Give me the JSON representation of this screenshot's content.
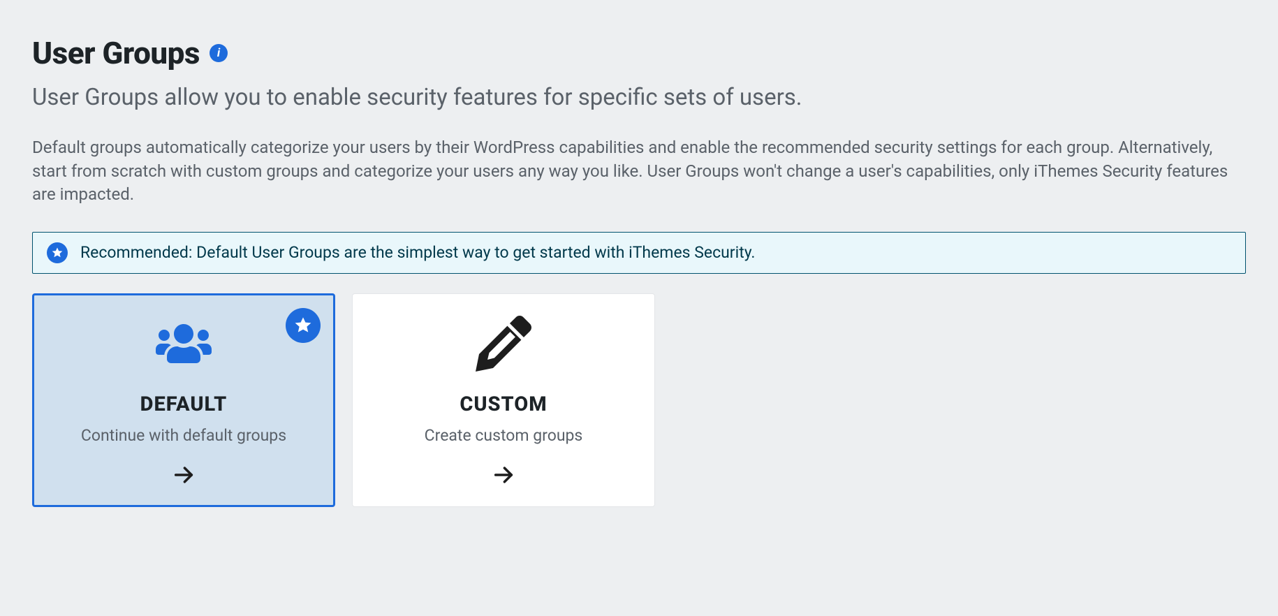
{
  "header": {
    "title": "User Groups",
    "info_icon": "info-icon"
  },
  "lead": "User Groups allow you to enable security features for specific sets of users.",
  "description": "Default groups automatically categorize your users by their WordPress capabilities and enable the recommended security settings for each group. Alternatively, start from scratch with custom groups and categorize your users any way you like. User Groups won't change a user's capabilities, only iThemes Security features are impacted.",
  "banner": {
    "text": "Recommended: Default User Groups are the simplest way to get started with iThemes Security."
  },
  "cards": {
    "default": {
      "title": "DEFAULT",
      "subtitle": "Continue with default groups"
    },
    "custom": {
      "title": "CUSTOM",
      "subtitle": "Create custom groups"
    }
  }
}
